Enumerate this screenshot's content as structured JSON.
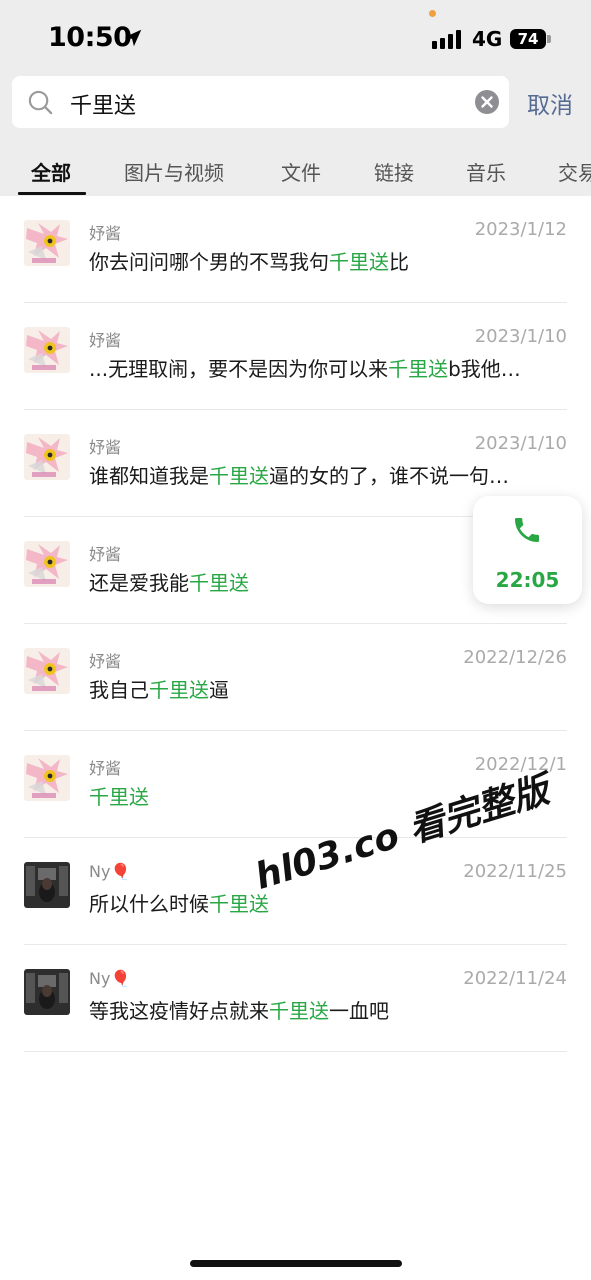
{
  "status_bar": {
    "time": "10:50",
    "network": "4G",
    "battery": "74"
  },
  "search": {
    "query": "千里送",
    "cancel_label": "取消"
  },
  "tabs": [
    {
      "label": "全部",
      "active": true
    },
    {
      "label": "图片与视频",
      "active": false
    },
    {
      "label": "文件",
      "active": false
    },
    {
      "label": "链接",
      "active": false
    },
    {
      "label": "音乐",
      "active": false
    },
    {
      "label": "交易",
      "active": false
    }
  ],
  "results": [
    {
      "sender": "妤酱",
      "date": "2023/1/12",
      "before": "你去问问哪个男的不骂我句",
      "match": "千里送",
      "after": "比",
      "avatar": "sticker"
    },
    {
      "sender": "妤酱",
      "date": "2023/1/10",
      "before": "...无理取闹，要不是因为你可以来",
      "match": "千里送",
      "after": "b我他…",
      "avatar": "sticker"
    },
    {
      "sender": "妤酱",
      "date": "2023/1/10",
      "before": "谁都知道我是",
      "match": "千里送",
      "after": "逼的女的了，谁不说一句…",
      "avatar": "sticker"
    },
    {
      "sender": "妤酱",
      "date": "",
      "before": "还是爱我能",
      "match": "千里送",
      "after": "",
      "avatar": "sticker"
    },
    {
      "sender": "妤酱",
      "date": "2022/12/26",
      "before": "我自己",
      "match": "千里送",
      "after": "逼",
      "avatar": "sticker"
    },
    {
      "sender": "妤酱",
      "date": "2022/12/1",
      "before": "",
      "match": "千里送",
      "after": "",
      "avatar": "sticker"
    },
    {
      "sender": "Ny",
      "sender_emoji": "🎈",
      "date": "2022/11/25",
      "before": "所以什么时候",
      "match": "千里送",
      "after": "",
      "avatar": "photo"
    },
    {
      "sender": "Ny",
      "sender_emoji": "🎈",
      "date": "2022/11/24",
      "before": "等我这疫情好点就来",
      "match": "千里送",
      "after": "一血吧",
      "avatar": "photo"
    }
  ],
  "call_bubble": {
    "duration": "22:05",
    "icon": "phone-icon"
  },
  "watermark": "hl03.co 看完整版",
  "colors": {
    "highlight": "#29a745",
    "cancel": "#566b94",
    "background_top": "#ededed"
  }
}
